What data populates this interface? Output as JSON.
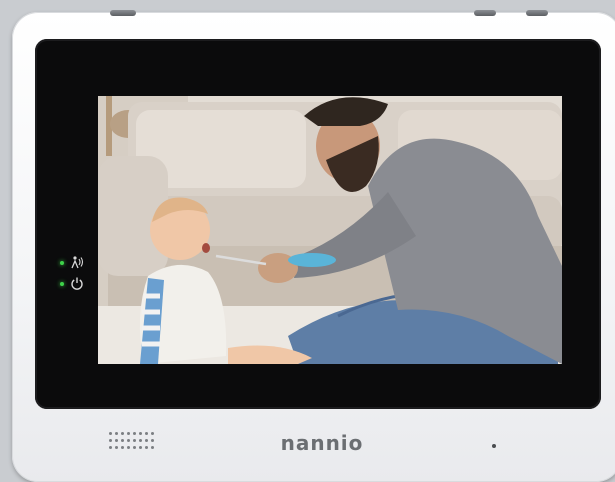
{
  "device": {
    "brand": "nannio"
  },
  "indicators": [
    {
      "icon": "audio-level-icon",
      "status": "on"
    },
    {
      "icon": "power-icon",
      "status": "on"
    }
  ],
  "screen": {
    "scene": "video-feed-image"
  },
  "colors": {
    "led": "#3ed34a",
    "bezel": "#0b0b0c",
    "body": "#f3f4f6"
  }
}
